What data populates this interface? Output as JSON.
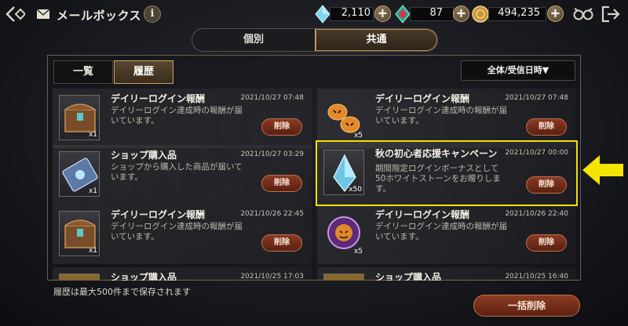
{
  "header": {
    "title": "メールボックス",
    "info_label": "i",
    "currencies": [
      {
        "icon": "blue-crystal-icon",
        "value": "2,110"
      },
      {
        "icon": "red-crystal-icon",
        "value": "87"
      },
      {
        "icon": "gold-coin-icon",
        "value": "494,235"
      }
    ],
    "plus_label": "+"
  },
  "main_tabs": [
    {
      "label": "個別",
      "selected": false
    },
    {
      "label": "共通",
      "selected": true
    }
  ],
  "sub_tabs": [
    {
      "label": "一覧",
      "selected": false
    },
    {
      "label": "履歴",
      "selected": true
    }
  ],
  "sort_label": "全体/受信日時▼",
  "items": [
    {
      "title": "デイリーログイン報酬",
      "date": "2021/10/27 07:48",
      "desc": "デイリーログイン達成時の報酬が届いています。",
      "qty": "x1",
      "icon": "treasure-chest-icon",
      "delete": "削除"
    },
    {
      "title": "デイリーログイン報酬",
      "date": "2021/10/27 07:48",
      "desc": "デイリーログイン達成時の報酬が届いています。",
      "qty": "x5",
      "icon": "pumpkin-icon",
      "delete": "削除"
    },
    {
      "title": "ショップ購入品",
      "date": "2021/10/27 03:29",
      "desc": "ショップから購入した商品が届いています。",
      "qty": "x1",
      "icon": "ticket-icon",
      "delete": "削除"
    },
    {
      "title": "秋の初心者応援キャンペーン",
      "date": "2021/10/27 00:00",
      "desc": "期間限定ログインボーナスとして50ホワイトストーンをお贈りします。",
      "qty": "x50",
      "icon": "white-stone-icon",
      "delete": "削除"
    },
    {
      "title": "デイリーログイン報酬",
      "date": "2021/10/26 22:45",
      "desc": "デイリーログイン達成時の報酬が届いています。",
      "qty": "x1",
      "icon": "treasure-chest-icon",
      "delete": "削除"
    },
    {
      "title": "デイリーログイン報酬",
      "date": "2021/10/26 22:40",
      "desc": "デイリーログイン達成時の報酬が届いています。",
      "qty": "x5",
      "icon": "pumpkin-medal-icon",
      "delete": "削除"
    },
    {
      "title": "ショップ購入品",
      "date": "2021/10/25 17:03",
      "desc": "",
      "qty": "",
      "icon": "gold-pile-icon",
      "delete": ""
    },
    {
      "title": "ショップ購入品",
      "date": "2021/10/25 16:40",
      "desc": "",
      "qty": "",
      "icon": "gold-pile-icon",
      "delete": ""
    }
  ],
  "footer_note": "履歴は最大500件まで保存されます",
  "bulk_delete_label": "一括削除",
  "colors": {
    "highlight": "#f4e000",
    "accent": "#c9a36a",
    "delete": "#8a3a24"
  }
}
